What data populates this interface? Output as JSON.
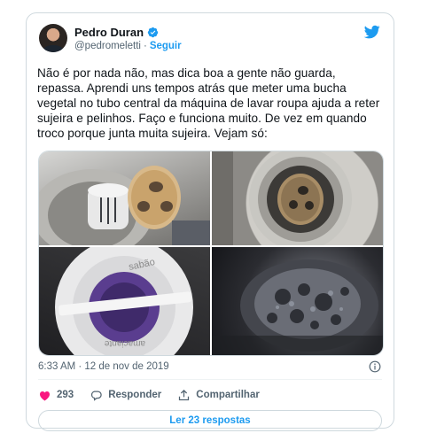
{
  "tweet": {
    "author": {
      "name": "Pedro Duran",
      "handle": "@pedromeletti",
      "separator": "·",
      "follow_label": "Seguir"
    },
    "text": "Não é por nada não, mas dica boa a gente não guarda, repassa. Aprendi uns tempos atrás que meter uma bucha vegetal no tubo central da máquina de lavar roupa ajuda a reter sujeira e pelinhos. Faço e funciona muito. De vez em quando troco porque junta muita sujeira. Vejam só:",
    "photo_texts": {
      "label_top": "sabão",
      "label_bottom": "amaciante"
    },
    "timestamp": "6:33 AM · 12 de nov de 2019",
    "actions": {
      "likes": "293",
      "reply_label": "Responder",
      "share_label": "Compartilhar"
    },
    "read_replies": "Ler 23 respostas"
  },
  "colors": {
    "brand_blue": "#1d9bf0",
    "like_pink": "#f91880",
    "text_secondary": "#536471"
  },
  "icons": [
    "verified-badge-icon",
    "twitter-bird-icon",
    "info-icon",
    "heart-icon",
    "reply-icon",
    "share-icon"
  ]
}
